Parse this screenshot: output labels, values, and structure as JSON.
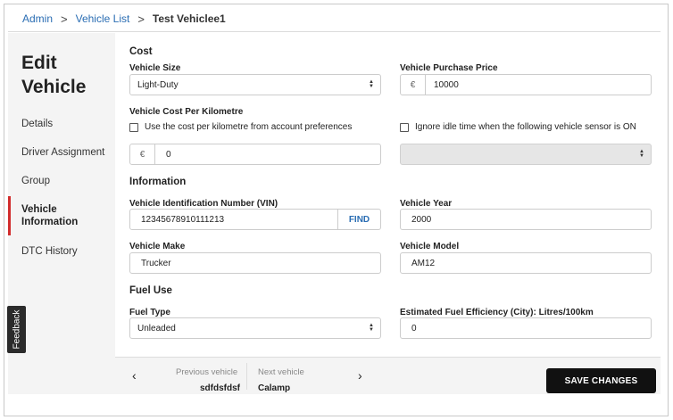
{
  "breadcrumb": {
    "admin": "Admin",
    "vehicle_list": "Vehicle List",
    "current": "Test Vehiclee1",
    "separator": ">"
  },
  "sidebar": {
    "title_line1": "Edit",
    "title_line2": "Vehicle",
    "items": [
      {
        "label": "Details"
      },
      {
        "label": "Driver Assignment"
      },
      {
        "label": "Group"
      },
      {
        "label": "Vehicle Information",
        "active": true
      },
      {
        "label": "DTC History"
      }
    ]
  },
  "feedback": {
    "label": "Feedback"
  },
  "cost": {
    "title": "Cost",
    "vehicle_size_label": "Vehicle Size",
    "vehicle_size_value": "Light-Duty",
    "purchase_price_label": "Vehicle Purchase Price",
    "purchase_price_currency": "€",
    "purchase_price_value": "10000",
    "cost_per_km_label": "Vehicle Cost Per Kilometre",
    "use_account_pref_label": "Use the cost per kilometre from account preferences",
    "use_account_pref_checked": false,
    "ignore_idle_label": "Ignore idle time when the following vehicle sensor is ON",
    "ignore_idle_checked": false,
    "cost_per_km_currency": "€",
    "cost_per_km_value": "0",
    "sensor_select_value": ""
  },
  "information": {
    "title": "Information",
    "vin_label": "Vehicle Identification Number (VIN)",
    "vin_value": "12345678910111213",
    "find_label": "FIND",
    "year_label": "Vehicle Year",
    "year_value": "2000",
    "make_label": "Vehicle Make",
    "make_value": "Trucker",
    "model_label": "Vehicle Model",
    "model_value": "AM12"
  },
  "fuel": {
    "title": "Fuel Use",
    "fuel_type_label": "Fuel Type",
    "fuel_type_value": "Unleaded",
    "efficiency_label": "Estimated Fuel Efficiency (City):  Litres/100km",
    "efficiency_value": "0"
  },
  "footer": {
    "prev_caption": "Previous vehicle",
    "prev_name": "sdfdsfdsf",
    "next_caption": "Next vehicle",
    "next_name": "Calamp",
    "prev_arrow": "‹",
    "next_arrow": "›",
    "save_label": "SAVE CHANGES"
  },
  "colors": {
    "accent": "#2a6db3",
    "active_bar": "#d12c2c",
    "save_button": "#111111"
  }
}
